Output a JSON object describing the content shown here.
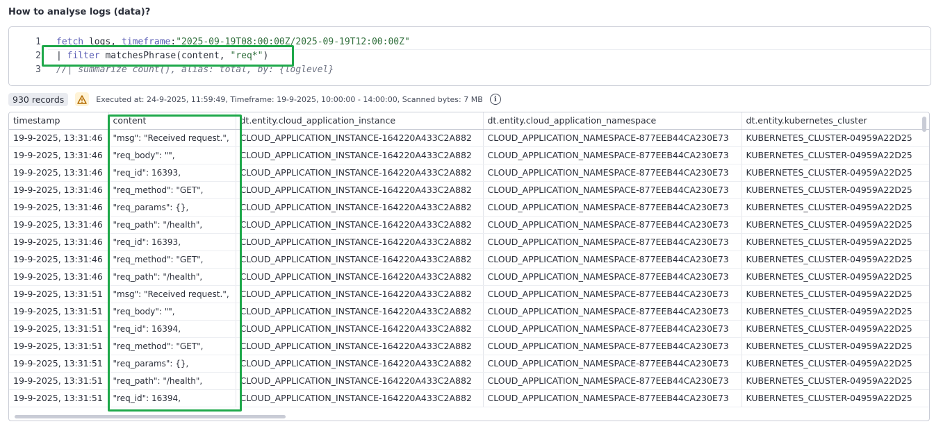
{
  "section_title": "How to analyse logs (data)?",
  "editor": {
    "line_numbers": [
      "1",
      "2",
      "3"
    ],
    "lines": [
      {
        "kw": "fetch",
        "name": " logs, ",
        "attr": "timeframe",
        "colon": ":",
        "str": "\"2025-09-19T08:00:00Z/2025-09-19T12:00:00Z\""
      },
      {
        "pipe": "| ",
        "kw": "filter",
        "fn": " matchesPhrase(content, ",
        "str": "\"req*\"",
        "close": ")"
      },
      {
        "comment": "//| summarize count(), alias: total, by: {loglevel}"
      }
    ]
  },
  "status": {
    "records": "930 records",
    "executed": "Executed at: 24-9-2025, 11:59:49, Timeframe: 19-9-2025, 10:00:00 - 14:00:00, Scanned bytes: 7 MB",
    "warning_icon": "warning-triangle-icon",
    "info_icon": "info-icon"
  },
  "table": {
    "columns": [
      "timestamp",
      "content",
      "dt.entity.cloud_application_instance",
      "dt.entity.cloud_application_namespace",
      "dt.entity.kubernetes_cluster"
    ],
    "rows": [
      [
        "19-9-2025, 13:31:46",
        "\"msg\": \"Received request.\",",
        "CLOUD_APPLICATION_INSTANCE-164220A433C2A882",
        "CLOUD_APPLICATION_NAMESPACE-877EEB44CA230E73",
        "KUBERNETES_CLUSTER-04959A22D25"
      ],
      [
        "19-9-2025, 13:31:46",
        "\"req_body\": \"\",",
        "CLOUD_APPLICATION_INSTANCE-164220A433C2A882",
        "CLOUD_APPLICATION_NAMESPACE-877EEB44CA230E73",
        "KUBERNETES_CLUSTER-04959A22D25"
      ],
      [
        "19-9-2025, 13:31:46",
        "\"req_id\": 16393,",
        "CLOUD_APPLICATION_INSTANCE-164220A433C2A882",
        "CLOUD_APPLICATION_NAMESPACE-877EEB44CA230E73",
        "KUBERNETES_CLUSTER-04959A22D25"
      ],
      [
        "19-9-2025, 13:31:46",
        "\"req_method\": \"GET\",",
        "CLOUD_APPLICATION_INSTANCE-164220A433C2A882",
        "CLOUD_APPLICATION_NAMESPACE-877EEB44CA230E73",
        "KUBERNETES_CLUSTER-04959A22D25"
      ],
      [
        "19-9-2025, 13:31:46",
        "\"req_params\": {},",
        "CLOUD_APPLICATION_INSTANCE-164220A433C2A882",
        "CLOUD_APPLICATION_NAMESPACE-877EEB44CA230E73",
        "KUBERNETES_CLUSTER-04959A22D25"
      ],
      [
        "19-9-2025, 13:31:46",
        "\"req_path\": \"/health\",",
        "CLOUD_APPLICATION_INSTANCE-164220A433C2A882",
        "CLOUD_APPLICATION_NAMESPACE-877EEB44CA230E73",
        "KUBERNETES_CLUSTER-04959A22D25"
      ],
      [
        "19-9-2025, 13:31:46",
        "\"req_id\": 16393,",
        "CLOUD_APPLICATION_INSTANCE-164220A433C2A882",
        "CLOUD_APPLICATION_NAMESPACE-877EEB44CA230E73",
        "KUBERNETES_CLUSTER-04959A22D25"
      ],
      [
        "19-9-2025, 13:31:46",
        "\"req_method\": \"GET\",",
        "CLOUD_APPLICATION_INSTANCE-164220A433C2A882",
        "CLOUD_APPLICATION_NAMESPACE-877EEB44CA230E73",
        "KUBERNETES_CLUSTER-04959A22D25"
      ],
      [
        "19-9-2025, 13:31:46",
        "\"req_path\": \"/health\",",
        "CLOUD_APPLICATION_INSTANCE-164220A433C2A882",
        "CLOUD_APPLICATION_NAMESPACE-877EEB44CA230E73",
        "KUBERNETES_CLUSTER-04959A22D25"
      ],
      [
        "19-9-2025, 13:31:51",
        "\"msg\": \"Received request.\",",
        "CLOUD_APPLICATION_INSTANCE-164220A433C2A882",
        "CLOUD_APPLICATION_NAMESPACE-877EEB44CA230E73",
        "KUBERNETES_CLUSTER-04959A22D25"
      ],
      [
        "19-9-2025, 13:31:51",
        "\"req_body\": \"\",",
        "CLOUD_APPLICATION_INSTANCE-164220A433C2A882",
        "CLOUD_APPLICATION_NAMESPACE-877EEB44CA230E73",
        "KUBERNETES_CLUSTER-04959A22D25"
      ],
      [
        "19-9-2025, 13:31:51",
        "\"req_id\": 16394,",
        "CLOUD_APPLICATION_INSTANCE-164220A433C2A882",
        "CLOUD_APPLICATION_NAMESPACE-877EEB44CA230E73",
        "KUBERNETES_CLUSTER-04959A22D25"
      ],
      [
        "19-9-2025, 13:31:51",
        "\"req_method\": \"GET\",",
        "CLOUD_APPLICATION_INSTANCE-164220A433C2A882",
        "CLOUD_APPLICATION_NAMESPACE-877EEB44CA230E73",
        "KUBERNETES_CLUSTER-04959A22D25"
      ],
      [
        "19-9-2025, 13:31:51",
        "\"req_params\": {},",
        "CLOUD_APPLICATION_INSTANCE-164220A433C2A882",
        "CLOUD_APPLICATION_NAMESPACE-877EEB44CA230E73",
        "KUBERNETES_CLUSTER-04959A22D25"
      ],
      [
        "19-9-2025, 13:31:51",
        "\"req_path\": \"/health\",",
        "CLOUD_APPLICATION_INSTANCE-164220A433C2A882",
        "CLOUD_APPLICATION_NAMESPACE-877EEB44CA230E73",
        "KUBERNETES_CLUSTER-04959A22D25"
      ],
      [
        "19-9-2025, 13:31:51",
        "\"req_id\": 16394,",
        "CLOUD_APPLICATION_INSTANCE-164220A433C2A882",
        "CLOUD_APPLICATION_NAMESPACE-877EEB44CA230E73",
        "KUBERNETES_CLUSTER-04959A22D25"
      ]
    ]
  },
  "colors": {
    "highlight": "#1ea84a",
    "keyword": "#5a5db5",
    "string": "#2f6e3b"
  }
}
